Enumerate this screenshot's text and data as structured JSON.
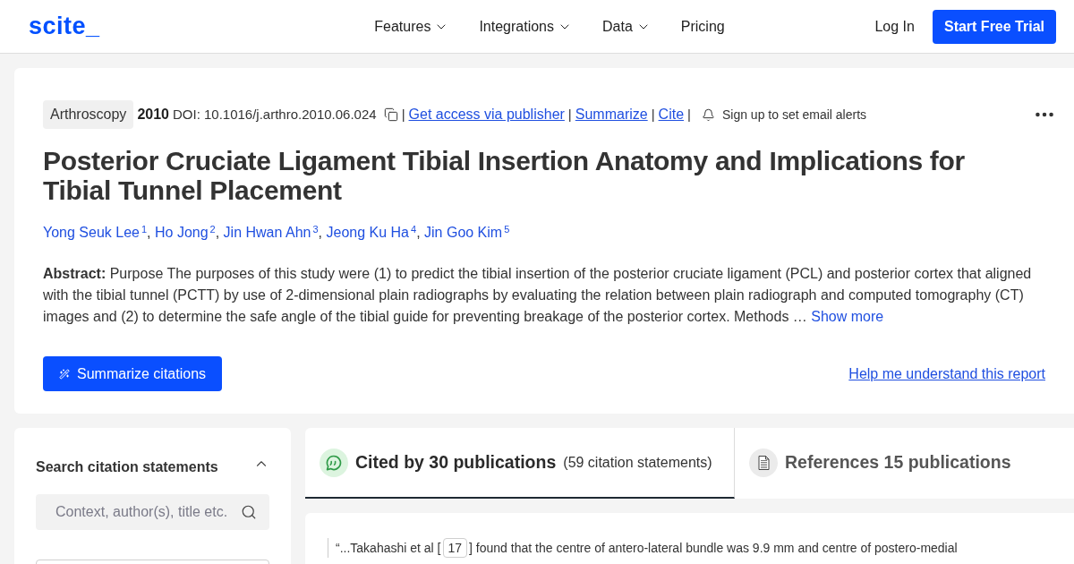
{
  "header": {
    "logo": "scite_",
    "nav": [
      {
        "label": "Features",
        "kind": "dropdown"
      },
      {
        "label": "Integrations",
        "kind": "dropdown"
      },
      {
        "label": "Data",
        "kind": "dropdown"
      },
      {
        "label": "Pricing",
        "kind": "link"
      }
    ],
    "login": "Log In",
    "cta": "Start Free Trial"
  },
  "article": {
    "journal": "Arthroscopy",
    "year": "2010",
    "doi": "DOI: 10.1016/j.arthro.2010.06.024",
    "meta_items": [
      {
        "kind": "separator",
        "text": "|"
      },
      {
        "kind": "link",
        "text": "Get access via publisher"
      },
      {
        "kind": "separator",
        "text": "|"
      },
      {
        "kind": "link",
        "text": "Summarize"
      },
      {
        "kind": "separator",
        "text": "|"
      },
      {
        "kind": "link",
        "text": "Cite"
      },
      {
        "kind": "separator",
        "text": "|"
      },
      {
        "kind": "alert",
        "text": "Sign up to set email alerts"
      }
    ],
    "title": "Posterior Cruciate Ligament Tibial Insertion Anatomy and Implications for Tibial Tunnel Placement",
    "authors": [
      {
        "name": "Yong Seuk Lee",
        "sup": "1",
        "suffix": ","
      },
      {
        "name": "Ho Jong",
        "sup": "2",
        "suffix": ","
      },
      {
        "name": "Jin Hwan Ahn",
        "sup": "3",
        "suffix": ","
      },
      {
        "name": "Jeong Ku Ha",
        "sup": "4",
        "suffix": ","
      },
      {
        "name": "Jin Goo Kim",
        "sup": "5"
      }
    ],
    "abstract": "**Abstract:** Purpose The purposes of this study were (1) to predict the tibial insertion of the posterior cruciate ligament (PCL) and posterior cortex that aligned with the tibial tunnel (PCTT) by use of 2-dimensional plain radiographs by evaluating the relation between plain radiograph and computed tomography (CT) images and (2) to determine the safe angle of the tibial guide for preventing breakage of the posterior cortex. Methods …",
    "show_more": "Show more",
    "summarize_button": "Summarize citations",
    "help_link": "Help me understand this report"
  },
  "search_panel": {
    "title": "Search citation statements",
    "expanded": true,
    "placeholder": "Context, author(s), title etc."
  },
  "tabs": [
    {
      "kind": "cited",
      "label": "Cited by 30 publications",
      "detail": "(59 citation statements)",
      "selected": true
    },
    {
      "kind": "references",
      "label": "References 15 publications",
      "selected": false
    }
  ],
  "citations": [
    {
      "before": "“...Takahashi et al [",
      "ref": "17",
      "after": "] found that the centre of antero-lateral bundle was 9.9 mm and centre of postero-medial"
    }
  ]
}
